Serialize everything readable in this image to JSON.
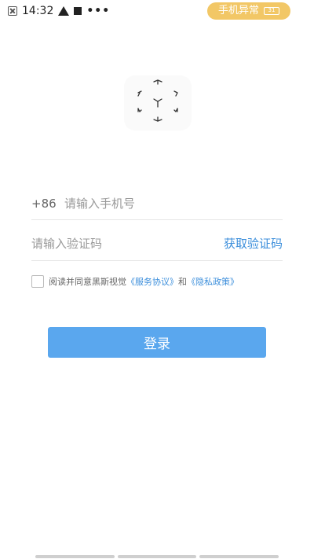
{
  "status_bar": {
    "time": "14:32",
    "dots": "•••",
    "pill_text": "手机异常",
    "battery_text": "31"
  },
  "logo": {
    "icon": "cube-logo-icon"
  },
  "phone": {
    "country_code": "+86",
    "placeholder": "请输入手机号",
    "value": ""
  },
  "code": {
    "placeholder": "请输入验证码",
    "value": "",
    "get_code_label": "获取验证码"
  },
  "agreement": {
    "checked": false,
    "prefix": "阅读并同意黑斯视觉",
    "service_link": "《服务协议》",
    "and": "和",
    "privacy_link": "《隐私政策》"
  },
  "login": {
    "label": "登录"
  },
  "colors": {
    "accent": "#3b8edb",
    "button": "#5aa7ee",
    "pill": "#f2c766"
  }
}
